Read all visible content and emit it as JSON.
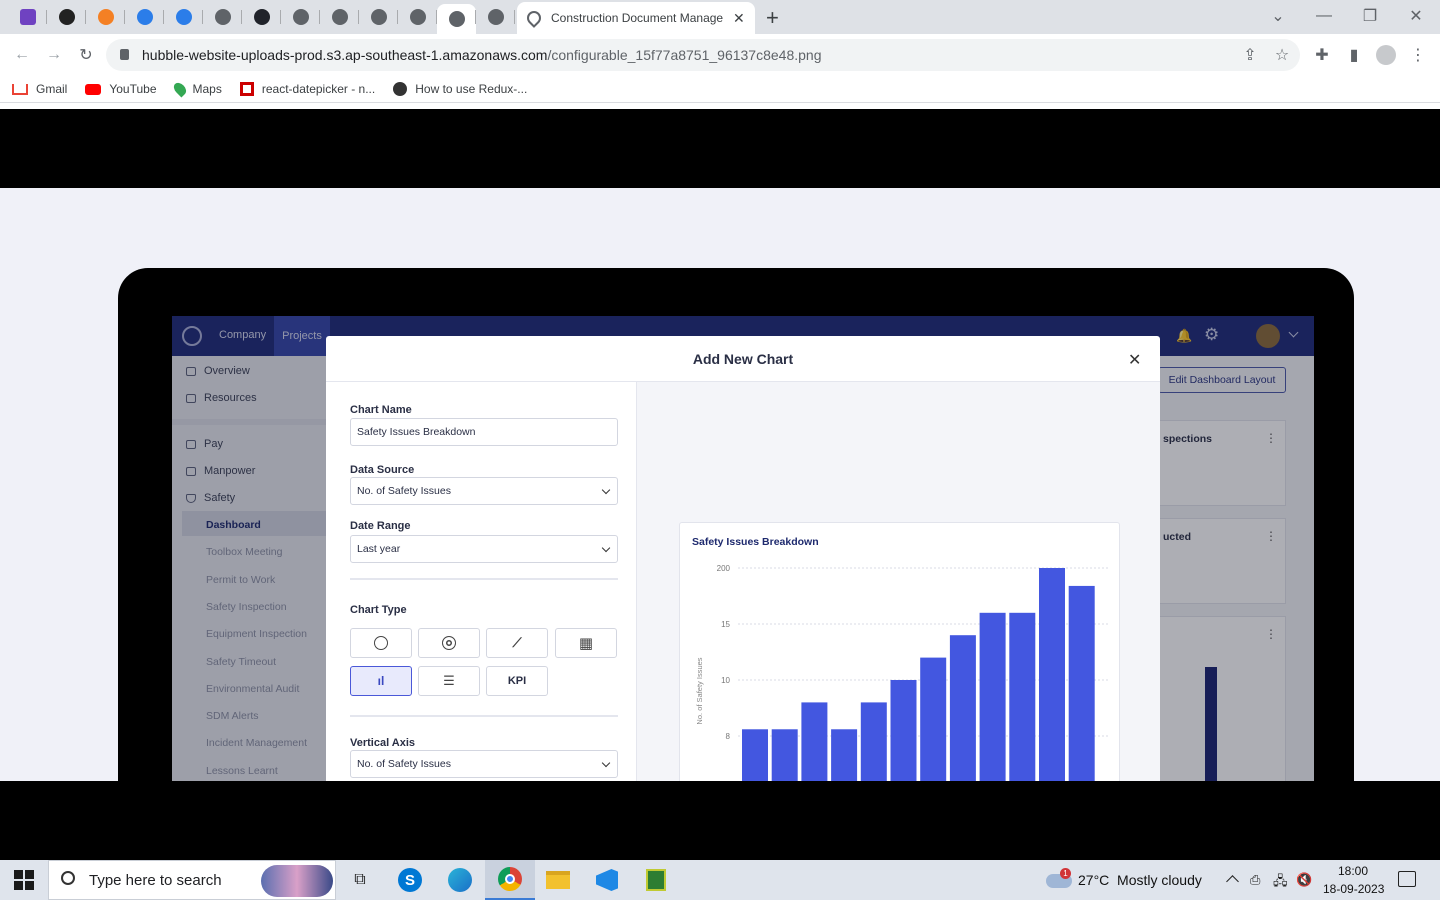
{
  "browser": {
    "active_tab_title": "Construction Document Manage",
    "new_tab": "+",
    "url_host": "hubble-website-uploads-prod.s3.ap-southeast-1.amazonaws.com",
    "url_path": "/configurable_15f77a8751_96137c8e48.png",
    "bookmarks": [
      {
        "label": "Gmail",
        "icon": "gmail-icon"
      },
      {
        "label": "YouTube",
        "icon": "youtube-icon"
      },
      {
        "label": "Maps",
        "icon": "maps-icon"
      },
      {
        "label": "react-datepicker - n...",
        "icon": "bookmark-red-icon"
      },
      {
        "label": "How to use Redux-...",
        "icon": "bookmark-globe-icon"
      }
    ]
  },
  "app": {
    "nav": {
      "company": "Company",
      "projects": "Projects"
    },
    "edit_layout_button": "Edit Dashboard Layout",
    "sidebar": {
      "items": [
        "Overview",
        "Resources",
        "Pay",
        "Manpower",
        "Safety"
      ],
      "sub_items": [
        "Dashboard",
        "Toolbox Meeting",
        "Permit to Work",
        "Safety Inspection",
        "Equipment Inspection",
        "Safety Timeout",
        "Environmental Audit",
        "SDM Alerts",
        "Incident Management",
        "Lessons Learnt"
      ]
    },
    "bg_cards": [
      "spections",
      "ucted"
    ]
  },
  "modal": {
    "title": "Add New Chart",
    "close": "✕",
    "chart_name_label": "Chart Name",
    "chart_name_value": "Safety Issues Breakdown",
    "data_source_label": "Data Source",
    "data_source_value": "No. of Safety Issues",
    "date_range_label": "Date Range",
    "date_range_value": "Last year",
    "chart_type_label": "Chart Type",
    "kpi_label": "KPI",
    "vertical_axis_label": "Vertical Axis",
    "vertical_axis_value": "No. of Safety Issues"
  },
  "chart_data": {
    "type": "bar",
    "title": "Safety Issues Breakdown",
    "xlabel": "",
    "ylabel": "No. of Safety Issues",
    "ytick_labels": [
      "200",
      "15",
      "10",
      "8"
    ],
    "values": [
      5.6,
      5.6,
      8,
      5.6,
      8,
      10,
      12,
      14,
      16,
      16,
      20,
      18.4
    ],
    "color": "#4357e0"
  },
  "taskbar": {
    "search_placeholder": "Type here to search",
    "weather": "27°C  Mostly cloudy",
    "weather_badge": "1",
    "time": "18:00",
    "date": "18-09-2023"
  }
}
